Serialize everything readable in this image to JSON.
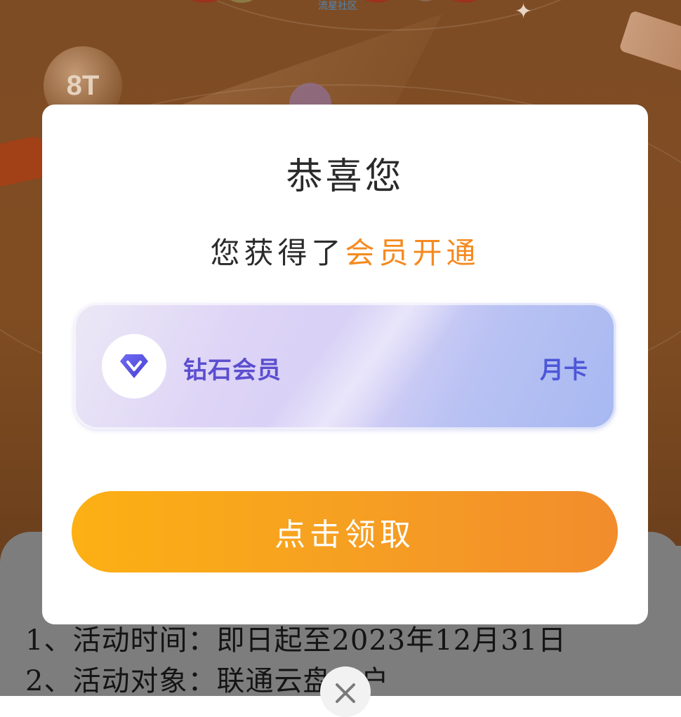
{
  "background": {
    "community_label": "流星社区",
    "ball_label": "8T",
    "rules": [
      "1、活动时间：即日起至2023年12月31日",
      "2、活动对象：联通云盘用户"
    ]
  },
  "modal": {
    "title": "恭喜您",
    "subtitle_prefix": "您获得了",
    "subtitle_highlight": "会员开通",
    "reward_card": {
      "icon": "diamond-icon",
      "name": "钻石会员",
      "period": "月卡"
    },
    "claim_button_label": "点击领取",
    "close_icon": "close-icon"
  },
  "colors": {
    "highlight": "#f58a1f",
    "button_start": "#fcb013",
    "button_end": "#f28c2c",
    "card_text": "#5b4ecf"
  }
}
